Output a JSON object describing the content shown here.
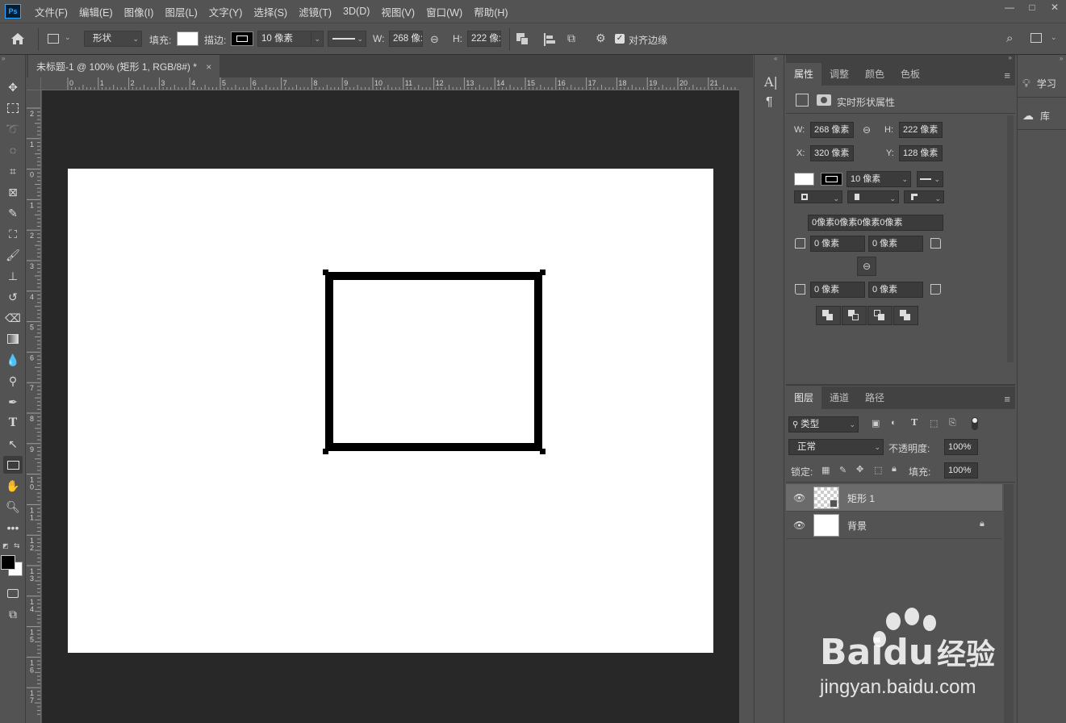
{
  "app": {
    "logo_text": "Ps"
  },
  "menu": [
    "文件(F)",
    "编辑(E)",
    "图像(I)",
    "图层(L)",
    "文字(Y)",
    "选择(S)",
    "滤镜(T)",
    "3D(D)",
    "视图(V)",
    "窗口(W)",
    "帮助(H)"
  ],
  "window_controls": [
    "—",
    "□",
    "✕"
  ],
  "options_bar": {
    "mode": "形状",
    "fill_label": "填充:",
    "stroke_label": "描边:",
    "stroke_width": "10 像素",
    "w_label": "W:",
    "w_value": "268 像:",
    "h_label": "H:",
    "h_value": "222 像:",
    "align_edges_label": "对齐边缘",
    "align_edges_checked": true
  },
  "document": {
    "tab_title": "未标题-1 @ 100% (矩形 1, RGB/8#) *",
    "close": "×"
  },
  "ruler": {
    "h_ticks": [
      "0",
      "1",
      "2",
      "3",
      "4",
      "5",
      "6",
      "7",
      "8",
      "9",
      "10",
      "11",
      "12",
      "13",
      "14",
      "15",
      "16",
      "17",
      "18",
      "19",
      "20",
      "21"
    ],
    "v_ticks": [
      "2",
      "1",
      "0",
      "1",
      "2",
      "3",
      "4",
      "5",
      "6",
      "7",
      "8",
      "9",
      "10",
      "11",
      "12",
      "13",
      "14",
      "15",
      "16",
      "17"
    ]
  },
  "properties_panel": {
    "tabs": [
      "属性",
      "调整",
      "颜色",
      "色板"
    ],
    "active_tab": "属性",
    "title": "实时形状属性",
    "w_label": "W:",
    "w": "268 像素",
    "h_label": "H:",
    "h": "222 像素",
    "x_label": "X:",
    "x": "320 像素",
    "y_label": "Y:",
    "y": "128 像素",
    "stroke_width": "10 像素",
    "corner_all": "0像素0像素0像素0像素",
    "corner_tl": "0 像素",
    "corner_tr": "0 像素",
    "corner_bl": "0 像素",
    "corner_br": "0 像素"
  },
  "layers_panel": {
    "tabs": [
      "图层",
      "通道",
      "路径"
    ],
    "active_tab": "图层",
    "filter": "类型",
    "blend_mode": "正常",
    "opacity_label": "不透明度:",
    "opacity": "100%",
    "lock_label": "锁定:",
    "fill_label": "填充:",
    "fill": "100%",
    "layers": [
      {
        "name": "矩形 1",
        "selected": true
      },
      {
        "name": "背景",
        "selected": false,
        "locked": true
      }
    ]
  },
  "right_dock": {
    "learn": "学习",
    "library": "库"
  },
  "watermark": {
    "brand": "Bai",
    "brand2": "du",
    "suffix": "经验",
    "url": "jingyan.baidu.com"
  },
  "colors": {
    "ui_bg": "#535353",
    "canvas_bg": "#282828",
    "accent": "#31a8ff"
  }
}
